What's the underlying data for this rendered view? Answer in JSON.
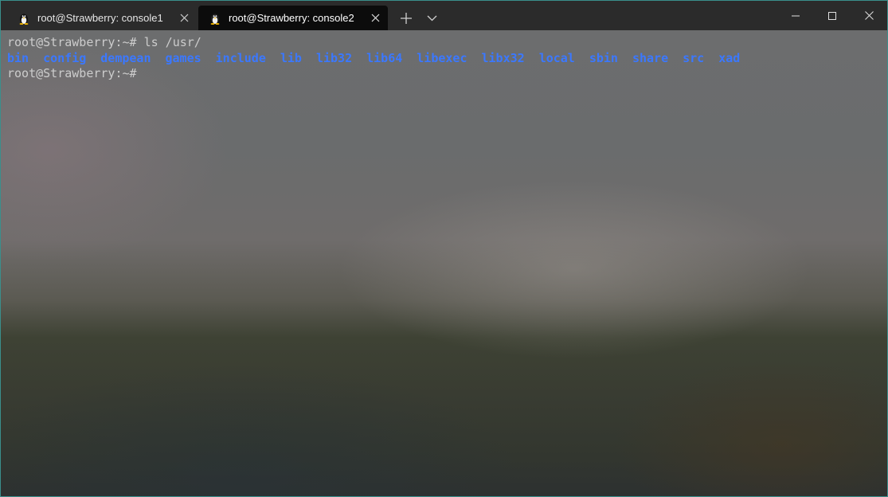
{
  "tabs": [
    {
      "label": "root@Strawberry: console1",
      "active": false
    },
    {
      "label": "root@Strawberry: console2",
      "active": true
    }
  ],
  "terminal": {
    "prompt": "root@Strawberry:~#",
    "command": "ls /usr/",
    "dirs": [
      "bin",
      "config",
      "dempean",
      "games",
      "include",
      "lib",
      "lib32",
      "lib64",
      "libexec",
      "libx32",
      "local",
      "sbin",
      "share",
      "src",
      "xad"
    ],
    "prompt2": "root@Strawberry:~#"
  },
  "colors": {
    "dir": "#3b78ff",
    "prompt": "#cccccc",
    "titlebar": "#2b2b2b",
    "active_tab": "#0c0c0c"
  },
  "icons": {
    "tab": "tux-penguin-icon",
    "close": "close-icon",
    "new_tab": "plus-icon",
    "dropdown": "chevron-down-icon",
    "minimize": "minimize-icon",
    "maximize": "maximize-icon",
    "window_close": "window-close-icon"
  }
}
